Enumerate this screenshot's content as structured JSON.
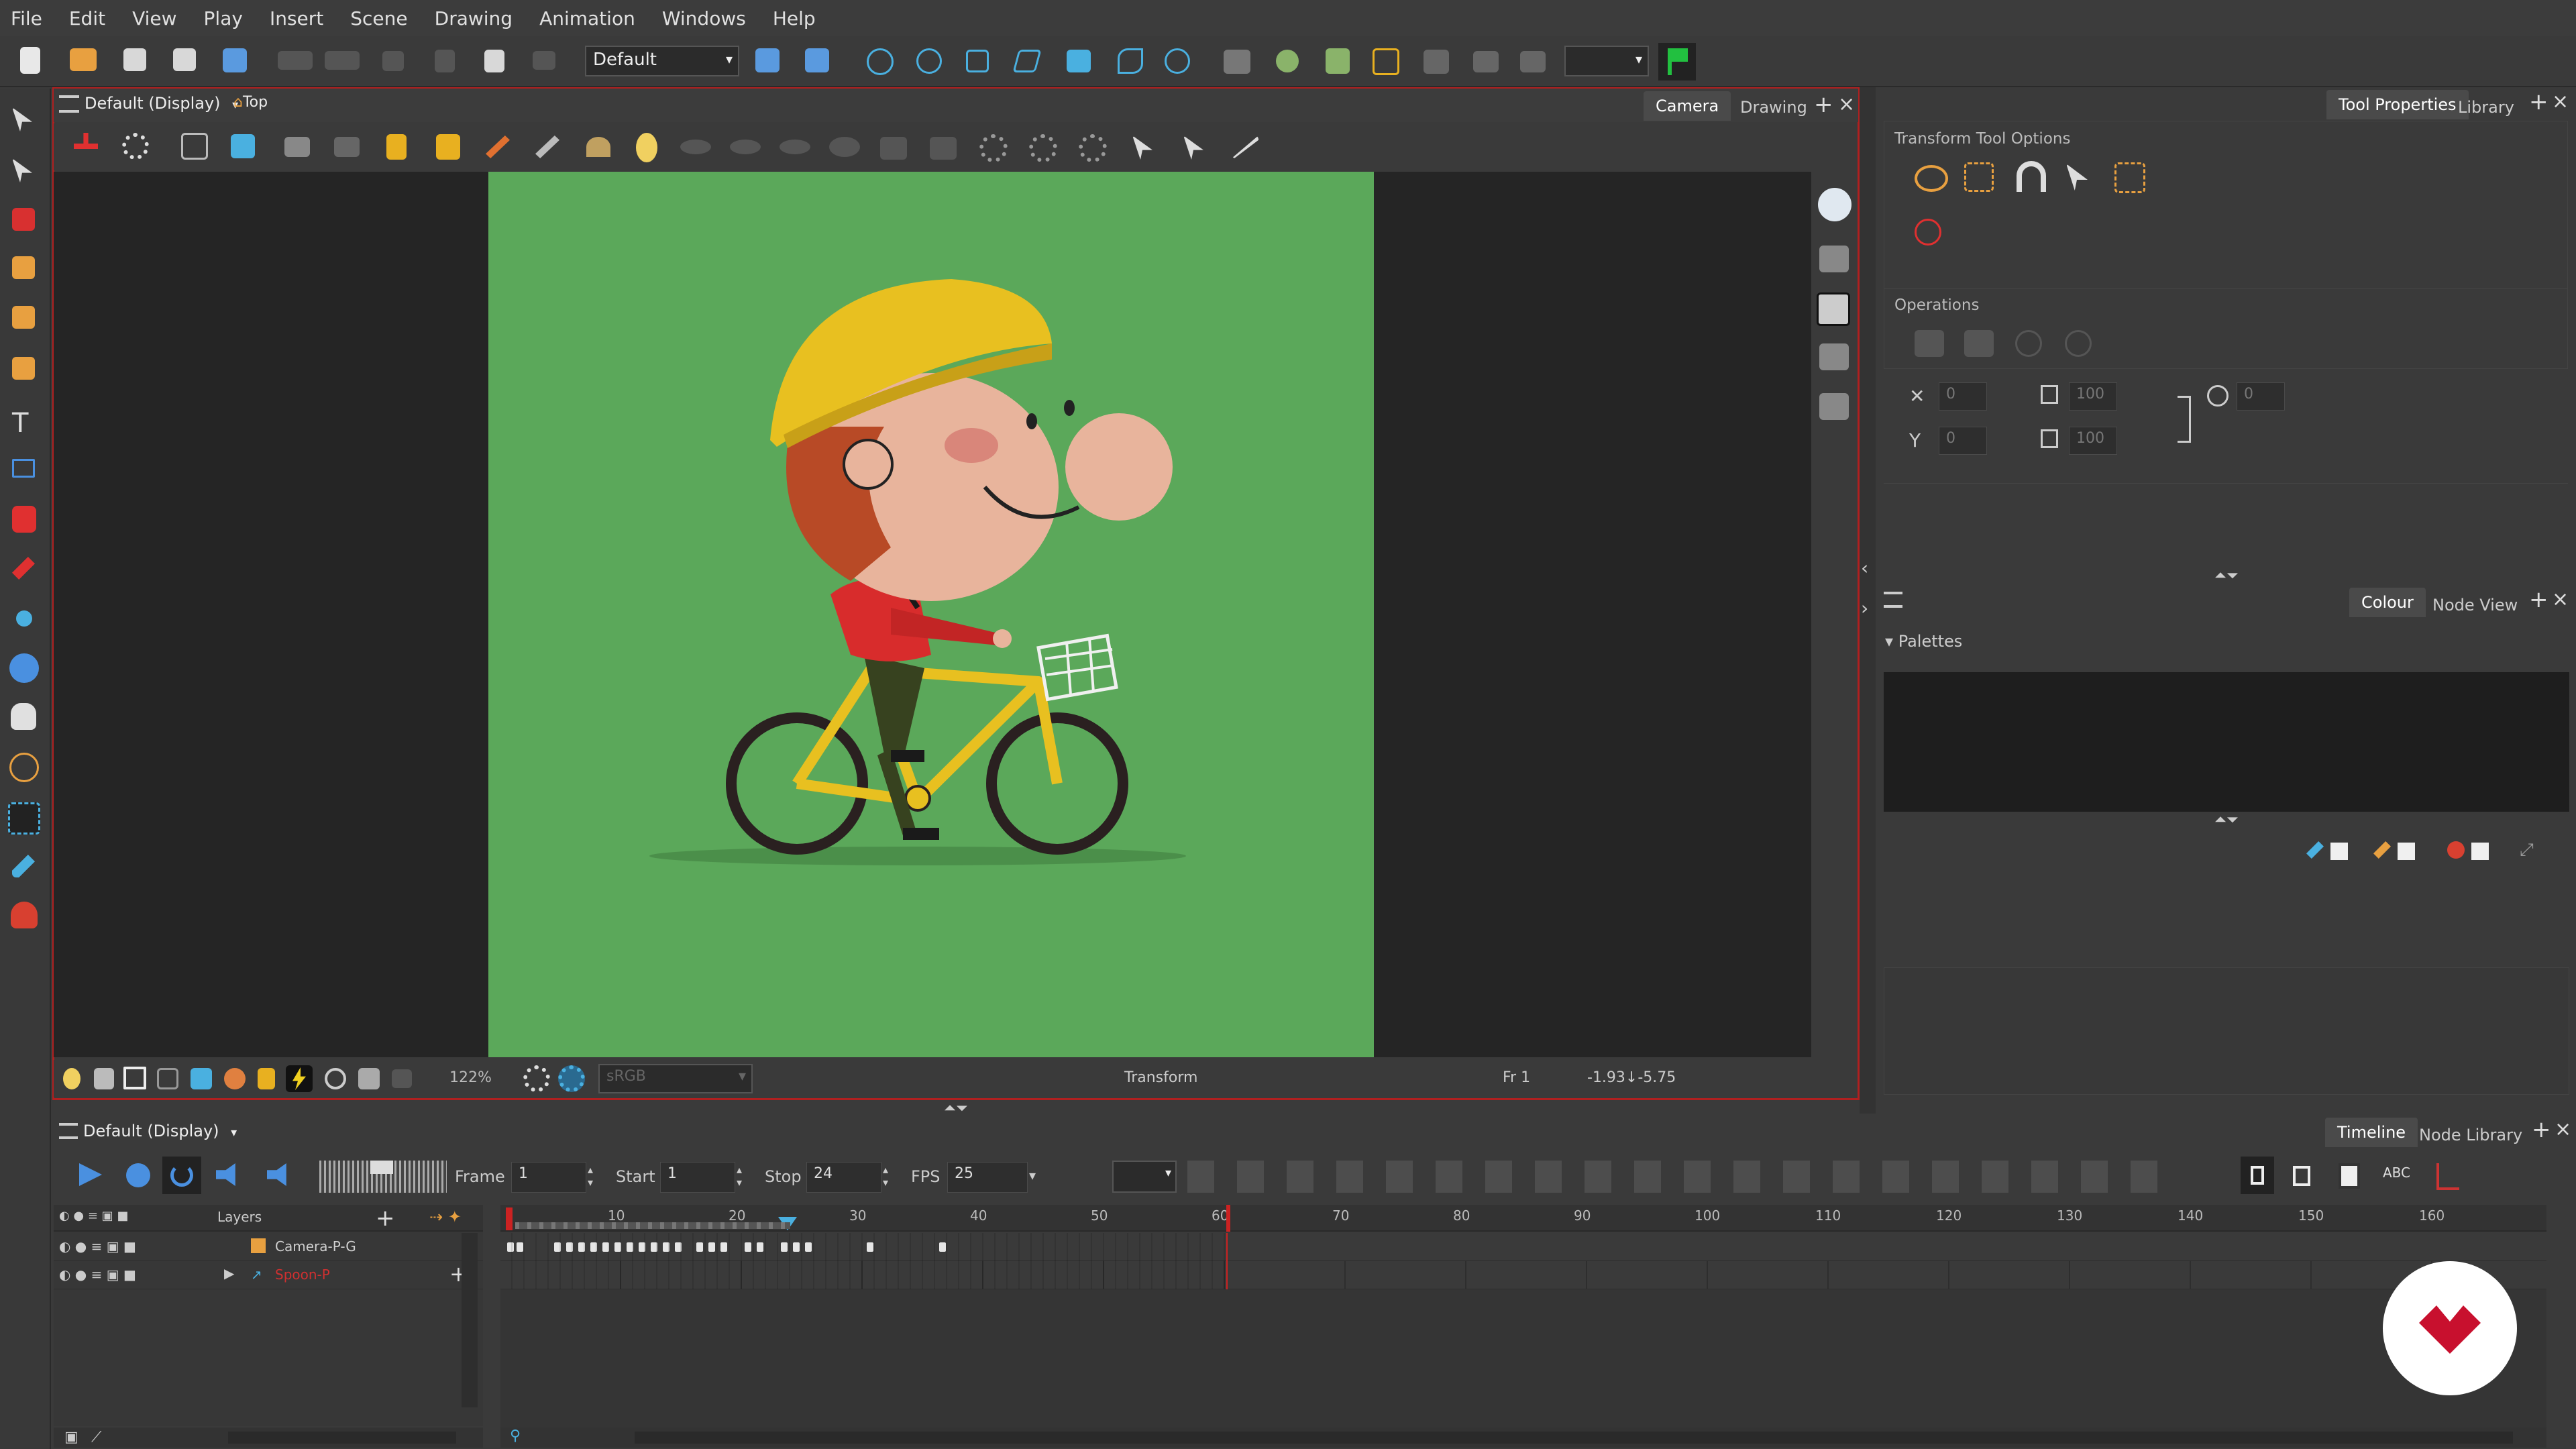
{
  "menu": [
    "File",
    "Edit",
    "View",
    "Play",
    "Insert",
    "Scene",
    "Drawing",
    "Animation",
    "Windows",
    "Help"
  ],
  "main_toolbar": {
    "workspace_select": "Default"
  },
  "camera_view": {
    "view_select": "Default (Display)",
    "view_mode": "Top",
    "tabs": [
      "Camera",
      "Drawing"
    ],
    "status": {
      "zoom": "122%",
      "colour_space": "sRGB",
      "tool": "Transform",
      "frame": "Fr 1",
      "coords": "-1.93↓-5.75"
    }
  },
  "tool_properties": {
    "tabs": [
      "Tool Properties",
      "Library"
    ],
    "section_title": "Transform Tool Options",
    "operations_title": "Operations",
    "fields": {
      "x": "0",
      "y": "0",
      "width": "100",
      "height": "100",
      "angle": "0"
    }
  },
  "colour_panel": {
    "tabs": [
      "Colour",
      "Node View"
    ],
    "palettes_title": "Palettes"
  },
  "timeline": {
    "view_select": "Default (Display)",
    "tabs": [
      "Timeline",
      "Node Library"
    ],
    "frame_label": "Frame",
    "frame_value": "1",
    "start_label": "Start",
    "start_value": "1",
    "stop_label": "Stop",
    "stop_value": "24",
    "fps_label": "FPS",
    "fps_value": "25",
    "layers_header": "Layers",
    "layers": [
      {
        "name": "Camera-P-G",
        "color": "#dddddd"
      },
      {
        "name": "Spoon-P",
        "color": "#d03030"
      }
    ],
    "ruler_ticks": [
      "10",
      "20",
      "30",
      "40",
      "50",
      "60",
      "70",
      "80",
      "90",
      "100",
      "110",
      "120",
      "130",
      "140",
      "150",
      "160"
    ]
  },
  "colors": {
    "accent_red": "#c42a2a",
    "stage_green": "#5ba85a",
    "playhead": "#cc2222",
    "logo_red": "#c8102e"
  }
}
